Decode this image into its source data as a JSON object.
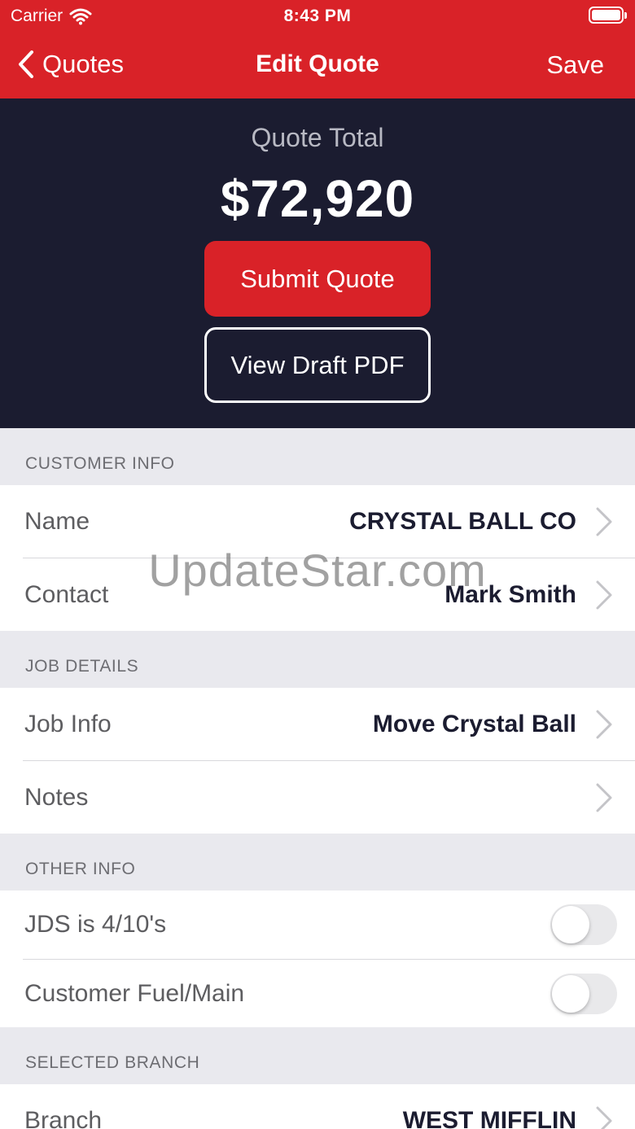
{
  "status_bar": {
    "carrier": "Carrier",
    "time": "8:43 PM"
  },
  "nav": {
    "back_label": "Quotes",
    "title": "Edit Quote",
    "save_label": "Save"
  },
  "hero": {
    "total_label": "Quote Total",
    "total_value": "$72,920",
    "submit_label": "Submit Quote",
    "pdf_label": "View Draft PDF"
  },
  "sections": {
    "customer_info": {
      "header": "CUSTOMER INFO",
      "name_label": "Name",
      "name_value": "CRYSTAL BALL CO",
      "contact_label": "Contact",
      "contact_value": "Mark Smith"
    },
    "job_details": {
      "header": "JOB DETAILS",
      "job_info_label": "Job Info",
      "job_info_value": "Move Crystal Ball",
      "notes_label": "Notes"
    },
    "other_info": {
      "header": "OTHER INFO",
      "jds_label": "JDS is 4/10's",
      "jds_on": false,
      "fuel_label": "Customer Fuel/Main",
      "fuel_on": false
    },
    "selected_branch": {
      "header": "SELECTED BRANCH",
      "branch_label": "Branch",
      "branch_value": "WEST MIFFLIN"
    }
  },
  "watermark": "UpdateStar.com",
  "colors": {
    "brand_red": "#d92228",
    "navy": "#1b1c30"
  }
}
